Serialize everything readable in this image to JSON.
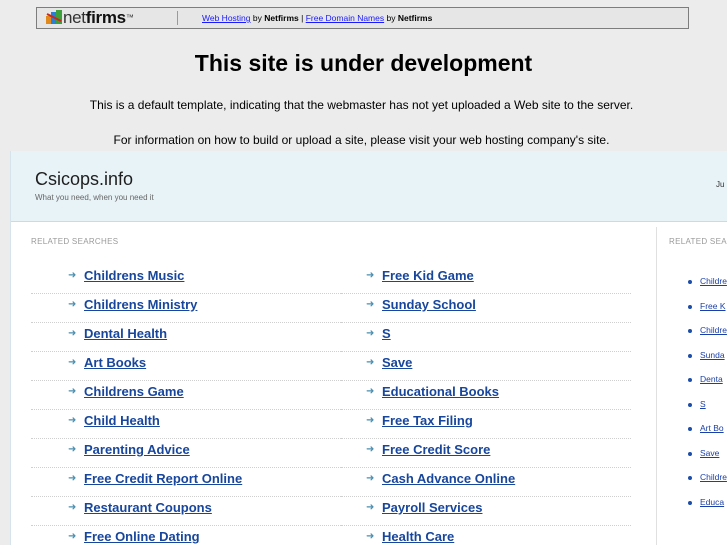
{
  "topbar": {
    "logo_text_light": "net",
    "logo_text_bold": "firms",
    "logo_tm": "™",
    "link1": "Web Hosting",
    "by1": "by",
    "brand1": "Netfirms",
    "divider": "|",
    "link2": "Free Domain Names",
    "by2": "by",
    "brand2": "Netfirms"
  },
  "headline": "This site is under development",
  "sub1": "This is a default template, indicating that the webmaster has not yet uploaded a Web site to the server.",
  "sub2": "For information on how to build or upload a site, please visit your web hosting company's site.",
  "panel": {
    "site_title": "Csicops.info",
    "tagline": "What you need, when you need it",
    "date": "Ju",
    "related_label": "RELATED SEARCHES",
    "related_label_right": "RELATED SEA",
    "col1": [
      "Childrens Music",
      "Childrens Ministry",
      "Dental Health",
      "Art Books",
      "Childrens Game",
      "Child Health",
      "Parenting Advice",
      "Free Credit Report Online",
      "Restaurant Coupons",
      "Free Online Dating"
    ],
    "col2": [
      "Free Kid Game",
      "Sunday School",
      "S",
      "Save",
      "Educational Books",
      "Free Tax Filing",
      "Free Credit Score",
      "Cash Advance Online",
      "Payroll Services",
      "Health Care"
    ],
    "side": [
      "Childre",
      "Free K",
      "Childre",
      "Sunda",
      "Denta",
      "S",
      "Art Bo",
      "Save",
      "Childre",
      "Educa"
    ]
  },
  "colors": {
    "link": "#17469c",
    "arrow": "#4a8fb0",
    "panel_header_bg": "#e8f3f8",
    "page_bg": "#ececec"
  }
}
